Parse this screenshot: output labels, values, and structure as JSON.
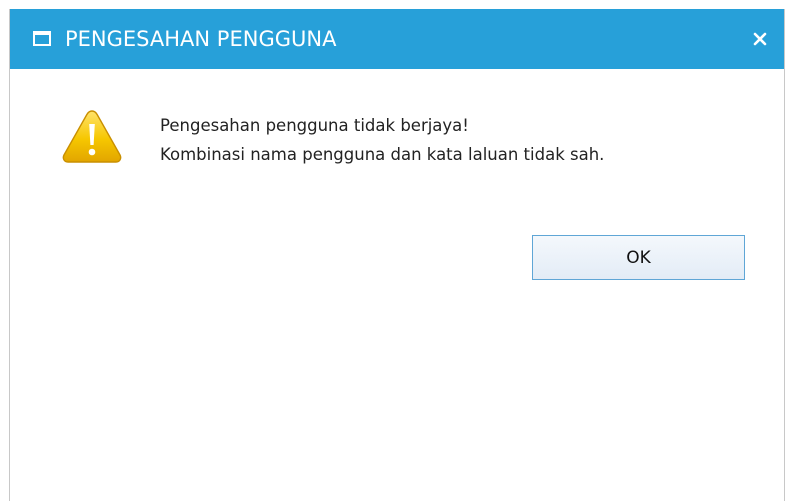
{
  "dialog": {
    "title": "PENGESAHAN PENGGUNA",
    "title_icon": "window-icon",
    "close_label": "×",
    "close_icon": "close-icon",
    "title_bar_color": "#27a0d9",
    "warning_icon": "warning-icon",
    "warning_color": "#f2c000",
    "message_lines": [
      "Pengesahan pengguna tidak berjaya!",
      "Kombinasi nama pengguna dan kata laluan tidak sah."
    ],
    "ok_label": "OK"
  }
}
